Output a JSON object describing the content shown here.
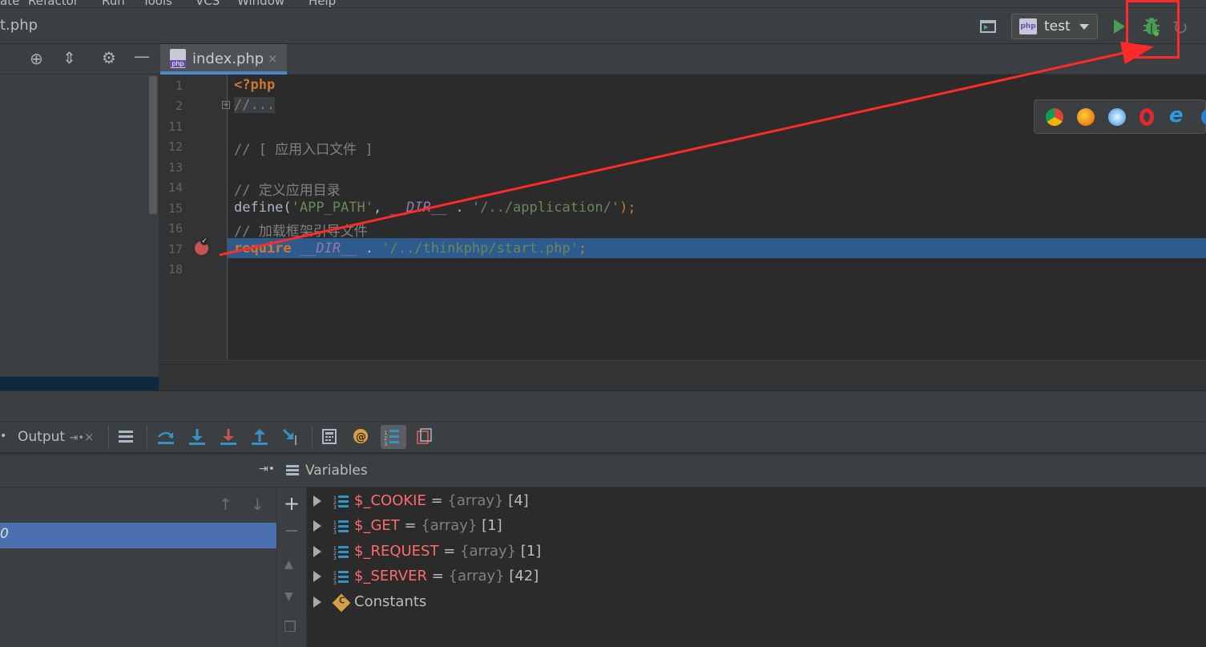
{
  "menubar": {
    "items": [
      "ate",
      "Refactor",
      "Run",
      "Tools",
      "VCS",
      "Window",
      "Help"
    ]
  },
  "navbar": {
    "breadcrumb": "t.php"
  },
  "run_config": {
    "label": "test",
    "icon": "php-icon"
  },
  "toolbar": {
    "run_icon": "run-icon",
    "debug_icon": "debug-bug-icon",
    "rerun_icon": "rerun-icon",
    "terminal_icon": "terminal-icon"
  },
  "editor": {
    "tab_label": "index.php",
    "tab_close": "×",
    "lines": [
      {
        "num": "1",
        "text": "<?php"
      },
      {
        "num": "2",
        "text": "//..."
      },
      {
        "num": "11",
        "text": ""
      },
      {
        "num": "12",
        "text": "// [ 应用入口文件 ]"
      },
      {
        "num": "13",
        "text": ""
      },
      {
        "num": "14",
        "text": "// 定义应用目录"
      },
      {
        "num": "15",
        "text": "define('APP_PATH', __DIR__ . '/../application/');"
      },
      {
        "num": "16",
        "text": "// 加载框架引导文件"
      },
      {
        "num": "17",
        "text": "require __DIR__ . '/../thinkphp/start.php';"
      },
      {
        "num": "18",
        "text": ""
      }
    ],
    "code_parts": {
      "l1": "<?php",
      "l2": "//...",
      "l12": "// [ 应用入口文件 ]",
      "l14": "// 定义应用目录",
      "l15_fn": "define(",
      "l15_str1": "'APP_PATH'",
      "l15_comma": ", ",
      "l15_dir": "__DIR__",
      "l15_dot": " . ",
      "l15_str2": "'/../application/'",
      "l15_end": ");",
      "l16": "// 加载框架引导文件",
      "l17_kw": "require",
      "l17_dir": "__DIR__",
      "l17_dot": " . ",
      "l17_str": "'/../thinkphp/start.php'",
      "l17_end": ";"
    }
  },
  "browsers": [
    "chrome-icon",
    "firefox-icon",
    "safari-icon",
    "opera-icon",
    "ie-icon",
    "edge-icon"
  ],
  "debug_toolbar": {
    "output_label": "Output",
    "output_pin": "⇥•",
    "output_close": "×"
  },
  "frames": {
    "selected_text": "0"
  },
  "variables": {
    "header": "Variables",
    "rows": [
      {
        "name": "$_COOKIE",
        "eq": " = ",
        "type": "{array}",
        "count": " [4]"
      },
      {
        "name": "$_GET",
        "eq": " = ",
        "type": "{array}",
        "count": " [1]"
      },
      {
        "name": "$_REQUEST",
        "eq": " = ",
        "type": "{array}",
        "count": " [1]"
      },
      {
        "name": "$_SERVER",
        "eq": " = ",
        "type": "{array}",
        "count": " [42]"
      }
    ],
    "constants_label": "Constants"
  },
  "colors": {
    "highlight": "#2d5b8e",
    "accent": "#4a88c7",
    "annotation": "#ff2a2a",
    "breakpoint": "#c75450"
  }
}
